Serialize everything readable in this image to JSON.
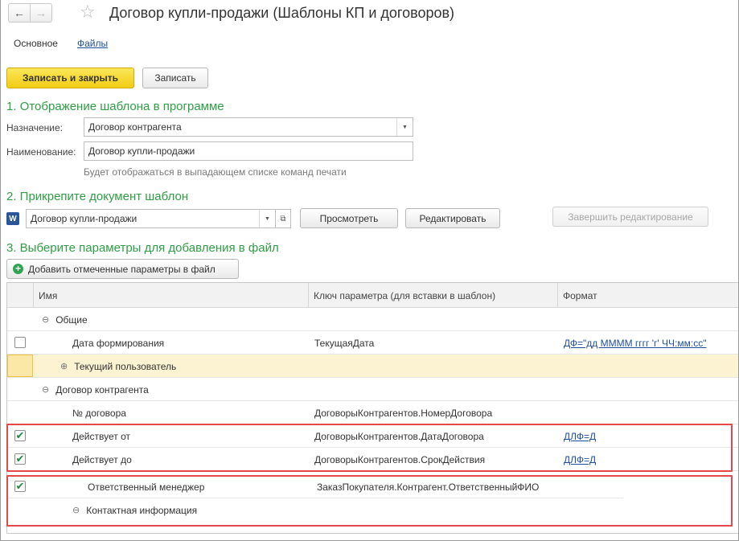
{
  "window": {
    "title": "Договор купли-продажи (Шаблоны КП и договоров)",
    "back_icon": "←",
    "forward_icon": "→",
    "favorite_icon": "☆"
  },
  "tabs": [
    {
      "label": "Основное"
    },
    {
      "label": "Файлы"
    }
  ],
  "toolbar": {
    "save_close_label": "Записать и закрыть",
    "save_label": "Записать"
  },
  "section1": {
    "title": "1. Отображение шаблона в программе",
    "purpose_label": "Назначение:",
    "purpose_value": "Договор контрагента",
    "name_label": "Наименование:",
    "name_value": "Договор купли-продажи",
    "hint": "Будет отображаться в выпадающем списке команд печати"
  },
  "section2": {
    "title": "2. Прикрепите документ шаблон",
    "file_icon": "W",
    "file_value": "Договор купли-продажи",
    "view_label": "Просмотреть",
    "edit_label": "Редактировать",
    "finish_edit_label": "Завершить редактирование"
  },
  "section3": {
    "title": "3. Выберите параметры для добавления в файл",
    "add_params_label": "Добавить отмеченные параметры в файл"
  },
  "table": {
    "columns": [
      "Имя",
      "Ключ параметра (для вставки в шаблон)",
      "Формат"
    ],
    "rows": [
      {
        "name": "Общие",
        "key": "",
        "format": "",
        "expander": "⊖"
      },
      {
        "name": "Дата формирования",
        "key": "ТекущаяДата",
        "format": "ДФ=\"дд ММММ гггг 'г' ЧЧ:мм:сс\"",
        "checked": false
      },
      {
        "name": "Текущий пользователь",
        "key": "",
        "format": "",
        "expander": "⊕",
        "selected": true
      },
      {
        "name": "Договор контрагента",
        "key": "",
        "format": "",
        "expander": "⊖"
      },
      {
        "name": "№ договора",
        "key": "ДоговорыКонтрагентов.НомерДоговора",
        "format": ""
      },
      {
        "name": "Действует от",
        "key": "ДоговорыКонтрагентов.ДатаДоговора",
        "format": "ДЛФ=Д",
        "checked": true
      },
      {
        "name": "Действует до",
        "key": "ДоговорыКонтрагентов.СрокДействия",
        "format": "ДЛФ=Д",
        "checked": true
      },
      {
        "name": "Ответственный менеджер",
        "key": "ЗаказПокупателя.Контрагент.ОтветственныйФИО",
        "format": "",
        "checked": true
      },
      {
        "name": "Контактная информация",
        "key": "",
        "format": "",
        "expander": "⊖"
      }
    ]
  },
  "checkmark": "✔",
  "colors": {
    "primary_button": "#f2cc14",
    "section_title": "#2f9e44",
    "highlight_box": "#e5474b",
    "selected_row": "#fbf3d2",
    "link": "#1f4e9b"
  }
}
